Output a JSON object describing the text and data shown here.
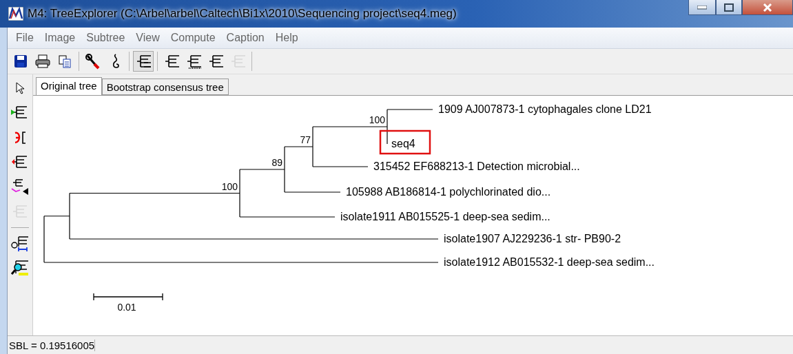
{
  "window": {
    "title": "M4: TreeExplorer (C:\\Arbel\\arbel\\Caltech\\Bi1x\\2010\\Sequencing project\\seq4.meg)"
  },
  "menu": [
    "File",
    "Image",
    "Subtree",
    "View",
    "Compute",
    "Caption",
    "Help"
  ],
  "toolbar": [
    {
      "kind": "button",
      "pressed": false,
      "disabled": false
    },
    {
      "kind": "button",
      "pressed": false,
      "disabled": false
    },
    {
      "kind": "button",
      "pressed": false,
      "disabled": false
    },
    {
      "kind": "separator"
    },
    {
      "kind": "button",
      "pressed": false,
      "disabled": false
    },
    {
      "kind": "button",
      "pressed": false,
      "disabled": false
    },
    {
      "kind": "separator"
    },
    {
      "kind": "button",
      "pressed": true,
      "disabled": false
    },
    {
      "kind": "separator"
    },
    {
      "kind": "button",
      "pressed": false,
      "disabled": false
    },
    {
      "kind": "button",
      "pressed": false,
      "disabled": false
    },
    {
      "kind": "button",
      "pressed": false,
      "disabled": false
    },
    {
      "kind": "button",
      "pressed": false,
      "disabled": true
    },
    {
      "kind": "separator"
    }
  ],
  "side_toolbar": [
    {
      "kind": "button",
      "disabled": false
    },
    {
      "kind": "button",
      "disabled": false
    },
    {
      "kind": "button",
      "disabled": false
    },
    {
      "kind": "button",
      "disabled": false
    },
    {
      "kind": "button",
      "disabled": false
    },
    {
      "kind": "button",
      "disabled": true
    },
    {
      "kind": "separator"
    },
    {
      "kind": "button",
      "disabled": false
    },
    {
      "kind": "button",
      "disabled": false
    }
  ],
  "tabs": [
    {
      "label": "Original tree",
      "selected": true
    },
    {
      "label": "Bootstrap consensus tree",
      "selected": false
    }
  ],
  "tree": {
    "children": [
      {
        "children": [
          {
            "support": "100",
            "children": [
              {
                "support": "89",
                "children": [
                  {
                    "support": "77",
                    "children": [
                      {
                        "support": "100",
                        "children": [
                          {
                            "label": "1909 AJ007873-1 cytophagales clone LD21",
                            "highlighted": false
                          },
                          {
                            "label": "seq4",
                            "highlighted": true
                          }
                        ]
                      },
                      {
                        "label": "315452 EF688213-1 Detection microbial...",
                        "highlighted": false
                      }
                    ]
                  },
                  {
                    "label": "105988 AB186814-1 polychlorinated dio...",
                    "highlighted": false
                  }
                ]
              },
              {
                "label": "isolate1911 AB015525-1 deep-sea sedim...",
                "highlighted": false
              }
            ]
          },
          {
            "label": "isolate1907 AJ229236-1 str- PB90-2",
            "highlighted": false
          }
        ]
      },
      {
        "label": "isolate1912 AB015532-1 deep-sea sedim...",
        "highlighted": false
      }
    ]
  },
  "scale_bar": {
    "label": "0.01"
  },
  "status_bar": "SBL = 0.19516005"
}
